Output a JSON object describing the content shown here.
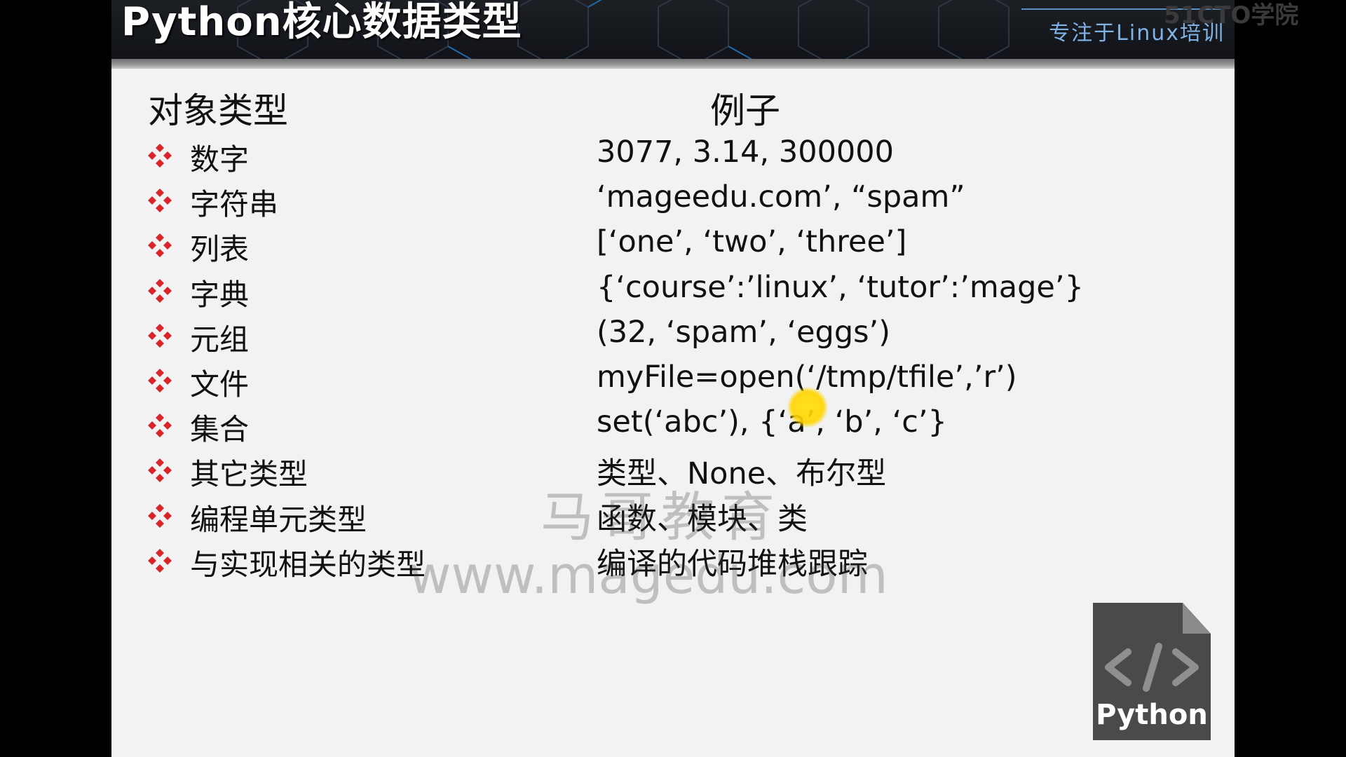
{
  "slide": {
    "title": "Python核心数据类型",
    "tagline": "专注于Linux培训",
    "brand": "51CTO学院"
  },
  "table": {
    "header_type": "对象类型",
    "header_example": "例子",
    "rows": [
      {
        "type": "数字",
        "example": "3077, 3.14, 300000"
      },
      {
        "type": "字符串",
        "example": "‘mageedu.com’, “spam”"
      },
      {
        "type": "列表",
        "example": "[‘one’, ‘two’, ‘three’]"
      },
      {
        "type": "字典",
        "example": "{‘course’:’linux’, ‘tutor’:’mage’}"
      },
      {
        "type": "元组",
        "example": "(32, ‘spam’, ‘eggs’)"
      },
      {
        "type": "文件",
        "example": "myFile=open(‘/tmp/tfile’,’r’)"
      },
      {
        "type": "集合",
        "example": "set(‘abc’), {‘a’, ‘b’, ‘c’}"
      },
      {
        "type": "其它类型",
        "example": "类型、None、布尔型"
      },
      {
        "type": "编程单元类型",
        "example": "函数、模块、类"
      },
      {
        "type": "与实现相关的类型",
        "example": "编译的代码堆栈跟踪"
      }
    ]
  },
  "watermark": {
    "name": "马哥教育",
    "url": "www.magedu.com"
  },
  "logo": {
    "icon": "code-brackets-icon",
    "label": "Python"
  },
  "colors": {
    "bullet": "#d9252a",
    "header_bg": "#15171b",
    "slide_bg": "#f2f2f2",
    "tagline": "#7fb3e6",
    "cursor_highlight": "#ffd400"
  }
}
